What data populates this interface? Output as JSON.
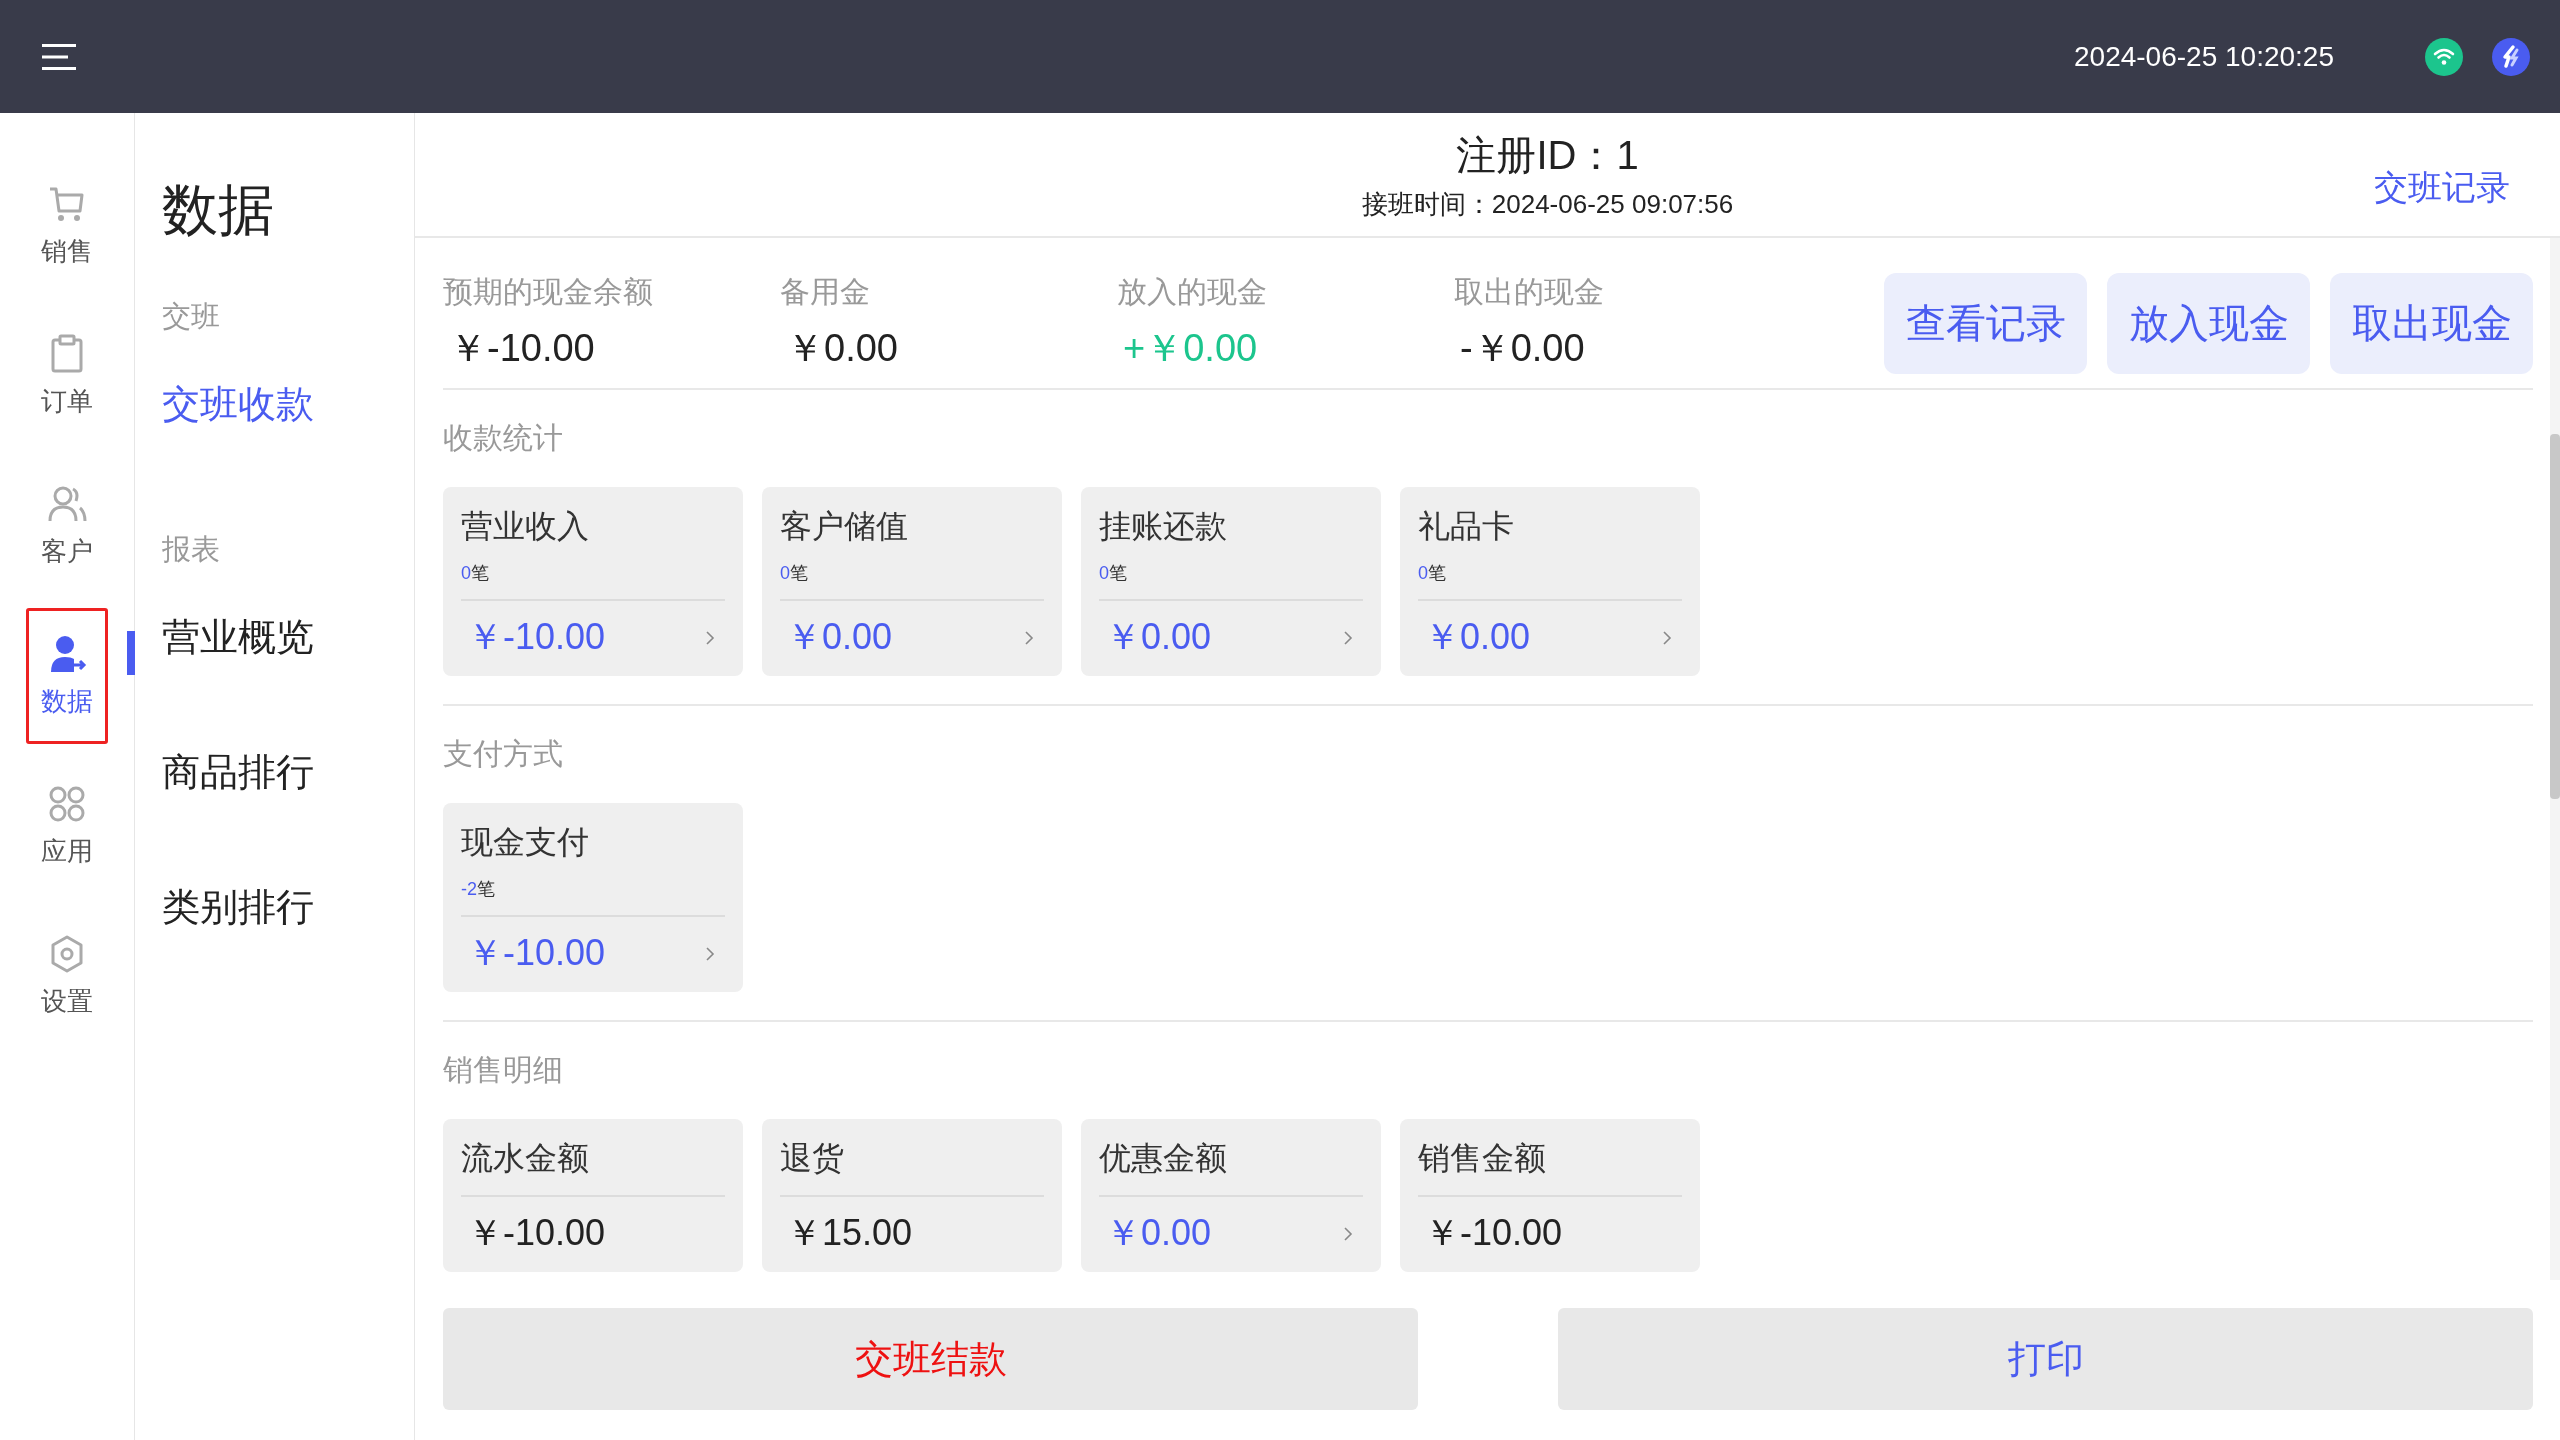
{
  "top_bar": {
    "datetime": "2024-06-25 10:20:25"
  },
  "nav_rail": {
    "items": [
      {
        "label": "销售",
        "selected": false
      },
      {
        "label": "订单",
        "selected": false
      },
      {
        "label": "客户",
        "selected": false
      },
      {
        "label": "数据",
        "selected": true
      },
      {
        "label": "应用",
        "selected": false
      },
      {
        "label": "设置",
        "selected": false
      }
    ]
  },
  "submenu": {
    "title": "数据",
    "groups": [
      {
        "label": "交班",
        "items": [
          {
            "label": "交班收款",
            "selected": true
          }
        ]
      },
      {
        "label": "报表",
        "items": [
          {
            "label": "营业概览",
            "selected": false
          },
          {
            "label": "商品排行",
            "selected": false
          },
          {
            "label": "类别排行",
            "selected": false
          }
        ]
      }
    ]
  },
  "header": {
    "register": "注册ID：1",
    "shift_time": "接班时间：2024-06-25 09:07:56",
    "history_link": "交班记录"
  },
  "cash_summary": [
    {
      "label": "预期的现金余额",
      "value": "￥-10.00",
      "kind": "plain"
    },
    {
      "label": "备用金",
      "value": "￥0.00",
      "kind": "plain"
    },
    {
      "label": "放入的现金",
      "value": "+￥0.00",
      "kind": "positive"
    },
    {
      "label": "取出的现金",
      "value": "-￥0.00",
      "kind": "plain"
    }
  ],
  "cash_buttons": [
    "查看记录",
    "放入现金",
    "取出现金"
  ],
  "sections": [
    {
      "title": "收款统计",
      "cards": [
        {
          "title": "营业收入",
          "count": "0",
          "unit": "笔",
          "amount": "￥-10.00",
          "linked": true
        },
        {
          "title": "客户储值",
          "count": "0",
          "unit": "笔",
          "amount": "￥0.00",
          "linked": true
        },
        {
          "title": "挂账还款",
          "count": "0",
          "unit": "笔",
          "amount": "￥0.00",
          "linked": true
        },
        {
          "title": "礼品卡",
          "count": "0",
          "unit": "笔",
          "amount": "￥0.00",
          "linked": true
        }
      ]
    },
    {
      "title": "支付方式",
      "cards": [
        {
          "title": "现金支付",
          "count": "-2",
          "unit": "笔",
          "amount": "￥-10.00",
          "linked": true
        }
      ]
    },
    {
      "title": "销售明细",
      "cards": [
        {
          "title": "流水金额",
          "amount": "￥-10.00",
          "linked": false
        },
        {
          "title": "退货",
          "amount": "￥15.00",
          "linked": false
        },
        {
          "title": "优惠金额",
          "amount": "￥0.00",
          "linked": true
        },
        {
          "title": "销售金额",
          "amount": "￥-10.00",
          "linked": false
        }
      ]
    }
  ],
  "footer_buttons": [
    {
      "label": "交班结款",
      "kind": "danger"
    },
    {
      "label": "打印",
      "kind": "primary"
    }
  ]
}
